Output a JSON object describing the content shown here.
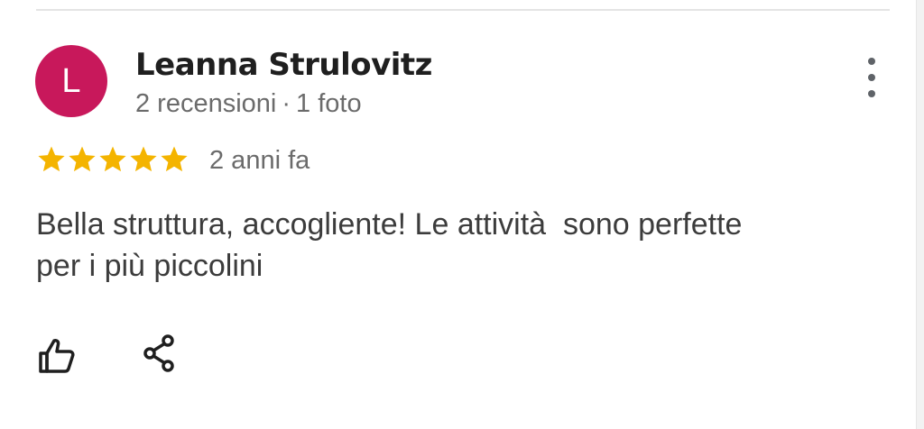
{
  "review": {
    "author": {
      "initial": "L",
      "name": "Leanna Strulovitz",
      "reviews_count": "2 recensioni",
      "separator": "·",
      "photos_count": "1 foto",
      "avatar_color": "#c8185b"
    },
    "rating": 5,
    "rating_max": 5,
    "star_color": "#f4b400",
    "date": "2 anni fa",
    "text_line1": "Bella struttura, accogliente! Le attività  sono perfette",
    "text_line2": "per i più piccolini"
  },
  "icons": {
    "more": "more-vert-icon",
    "like": "thumb-up-outline-icon",
    "share": "share-icon"
  }
}
